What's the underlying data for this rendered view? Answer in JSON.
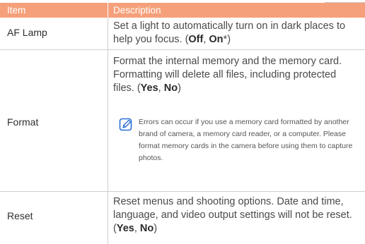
{
  "header": {
    "col_item": "Item",
    "col_description": "Description"
  },
  "rows": [
    {
      "item": "AF Lamp",
      "desc_text": "Set a light to automatically turn on in dark places to help you focus. (",
      "opt1": "Off",
      "sep": ", ",
      "opt2": "On",
      "suffix": "*)"
    },
    {
      "item": "Format",
      "desc_text": "Format the internal memory and the memory card. Formatting will delete all files, including protected files. (",
      "opt1": "Yes",
      "sep": ", ",
      "opt2": "No",
      "suffix": ")",
      "note": "Errors can occur if you use a memory card formatted by another brand of camera, a memory card reader, or a computer. Please format memory cards in the camera before using them to capture photos."
    },
    {
      "item": "Reset",
      "desc_text": "Reset menus and shooting options. Date and time, language, and video output settings will not be reset. (",
      "opt1": "Yes",
      "sep": ", ",
      "opt2": "No",
      "suffix": ")"
    }
  ],
  "icons": {
    "note_icon": "note-pencil-icon"
  },
  "colors": {
    "header_bg": "#f5a07a",
    "note_icon": "#2a6fd6"
  }
}
